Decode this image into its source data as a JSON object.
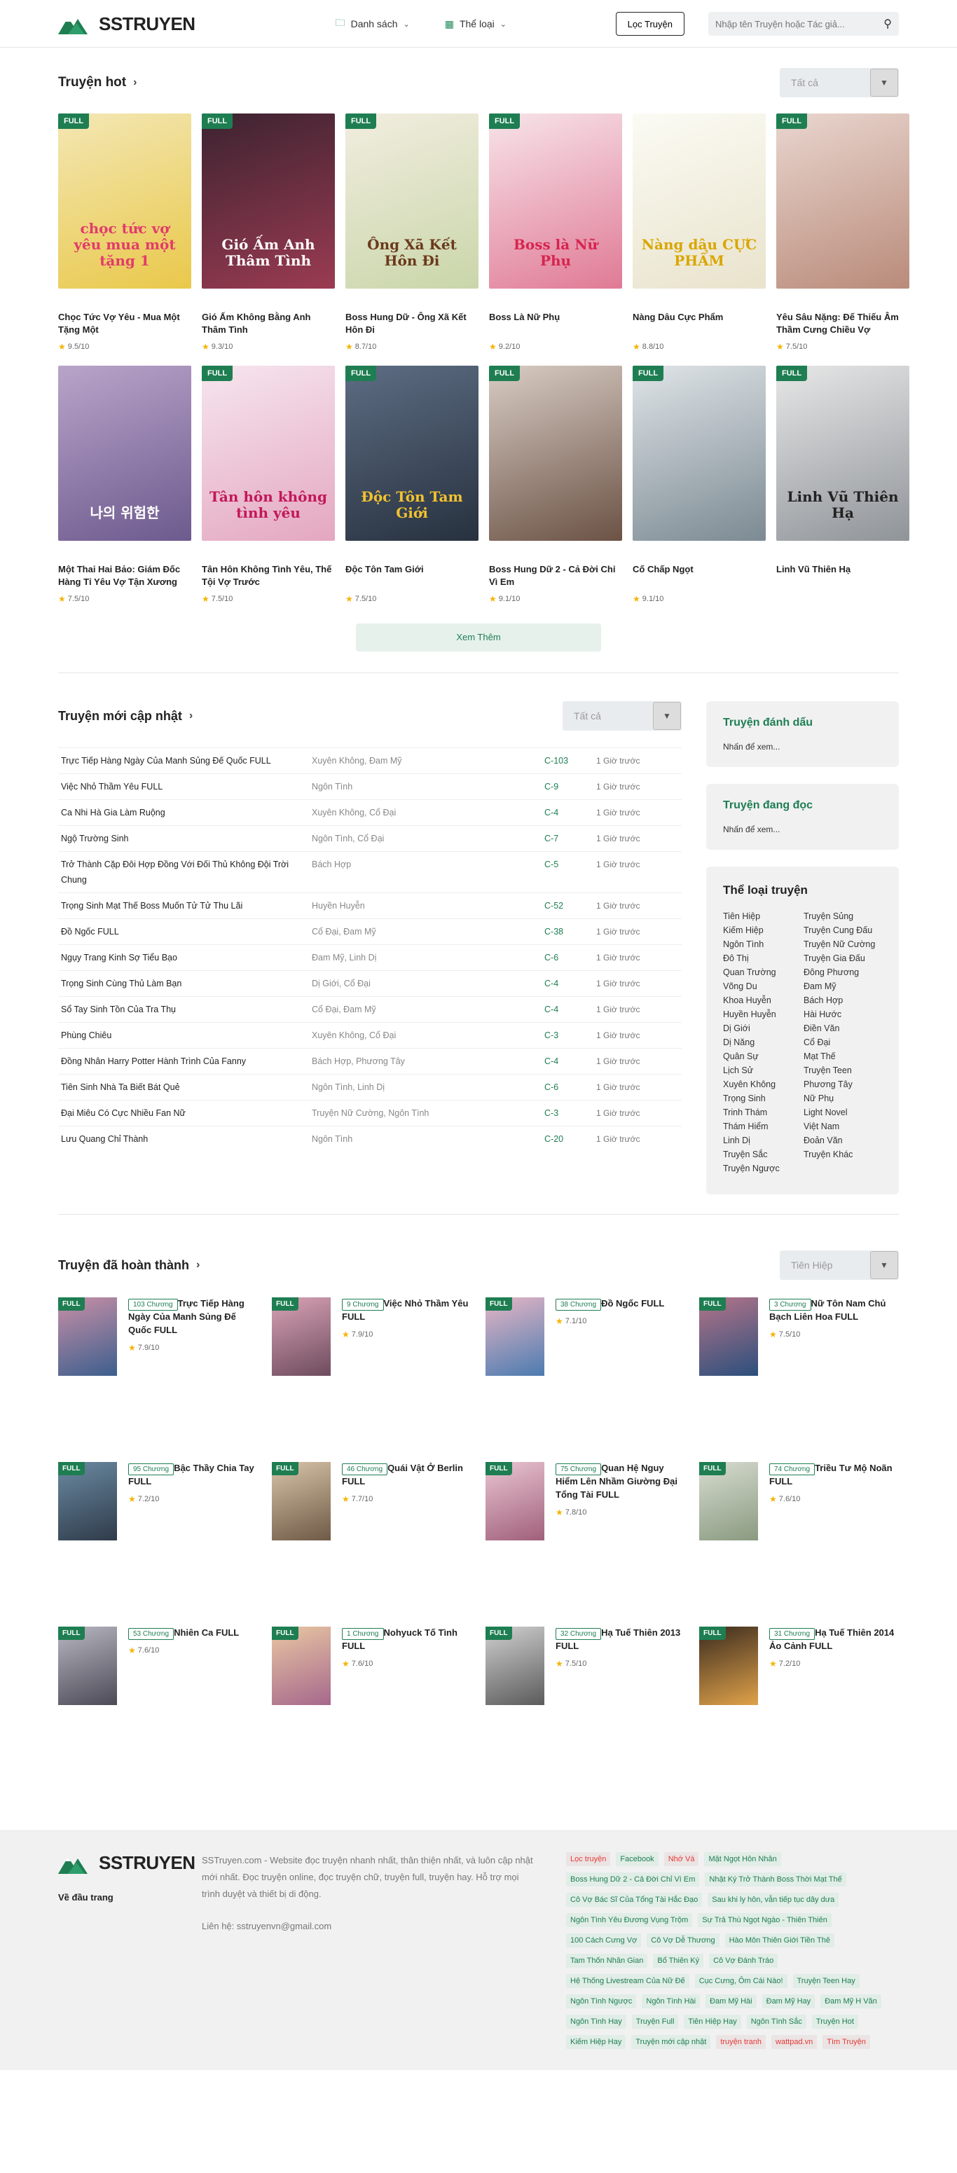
{
  "header": {
    "logo": "SSTRUYEN",
    "nav": [
      {
        "label": "Danh sách"
      },
      {
        "label": "Thể loại"
      }
    ],
    "filter_button": "Lọc Truyện",
    "search_placeholder": "Nhập tên Truyện hoặc Tác giả..."
  },
  "hot": {
    "title": "Truyện hot",
    "select": "Tất cả",
    "full_label": "FULL",
    "items": [
      {
        "title": "Chọc Tức Vợ Yêu - Mua Một Tặng Một",
        "rating": "9.5/10",
        "full": true,
        "cover_text": "chọc tức vợ yêu mua một tặng 1",
        "colors": [
          "#f3e7b4",
          "#e9c84a"
        ],
        "tc": "#e23b6b"
      },
      {
        "title": "Gió Ấm Không Bằng Anh Thâm Tình",
        "rating": "9.3/10",
        "full": true,
        "cover_text": "Gió Ấm Anh Thâm Tình",
        "colors": [
          "#3c2330",
          "#9b3b52"
        ],
        "tc": "#ffffff"
      },
      {
        "title": "Boss Hung Dữ - Ông Xã Kết Hôn Đi",
        "rating": "8.7/10",
        "full": true,
        "cover_text": "Ông Xã Kết Hôn Đi",
        "colors": [
          "#f2ede0",
          "#c9d6a9"
        ],
        "tc": "#6b3a1c"
      },
      {
        "title": "Boss Là Nữ Phụ",
        "rating": "9.2/10",
        "full": true,
        "cover_text": "Boss là Nữ Phụ",
        "colors": [
          "#f7e4ea",
          "#e07a95"
        ],
        "tc": "#d6254f"
      },
      {
        "title": "Nàng Dâu Cực Phẩm",
        "rating": "8.8/10",
        "full": false,
        "cover_text": "Nàng dâu CỰC PHẨM",
        "colors": [
          "#fbfbf4",
          "#e9e3cc"
        ],
        "tc": "#d9a600"
      },
      {
        "title": "Yêu Sâu Nặng: Đế Thiếu Âm Thầm Cưng Chiều Vợ",
        "rating": "7.5/10",
        "full": true,
        "cover_text": "",
        "colors": [
          "#e9d6cf",
          "#b98b7a"
        ],
        "tc": "#ffffff"
      },
      {
        "title": "Một Thai Hai Bảo: Giám Đốc Hàng Tỉ Yêu Vợ Tận Xương",
        "rating": "7.5/10",
        "full": false,
        "cover_text": "나의 위험한",
        "colors": [
          "#b9a4c9",
          "#6d5a8e"
        ],
        "tc": "#ffffff"
      },
      {
        "title": "Tân Hôn Không Tình Yêu, Thế Tội Vợ Trước",
        "rating": "7.5/10",
        "full": true,
        "cover_text": "Tân hôn không tình yêu",
        "colors": [
          "#f6e6ee",
          "#e4a7c0"
        ],
        "tc": "#c2185b"
      },
      {
        "title": "Độc Tôn Tam Giới",
        "rating": "7.5/10",
        "full": true,
        "cover_text": "Độc Tôn Tam Giới",
        "colors": [
          "#5d6d83",
          "#27313f"
        ],
        "tc": "#f2c230"
      },
      {
        "title": "Boss Hung Dữ 2 - Cả Đời Chỉ Vì Em",
        "rating": "9.1/10",
        "full": true,
        "cover_text": "",
        "colors": [
          "#d8ccc4",
          "#6b5245"
        ],
        "tc": "#ffffff"
      },
      {
        "title": "Cố Chấp Ngọt",
        "rating": "9.1/10",
        "full": true,
        "cover_text": "",
        "colors": [
          "#dfe4e7",
          "#7c8a93"
        ],
        "tc": "#ffffff"
      },
      {
        "title": "Linh Vũ Thiên Hạ",
        "rating": "",
        "full": true,
        "cover_text": "Linh Vũ Thiên Hạ",
        "colors": [
          "#e7e7e7",
          "#8f9499"
        ],
        "tc": "#222222"
      }
    ],
    "more_button": "Xem Thêm"
  },
  "updates": {
    "title": "Truyện mới cập nhật",
    "select": "Tất cả",
    "rows": [
      {
        "name": "Trực Tiếp Hàng Ngày Của Manh Sủng Đế Quốc FULL",
        "genre": "Xuyên Không, Đam Mỹ",
        "chapter": "C-103",
        "time": "1 Giờ trước"
      },
      {
        "name": "Việc Nhỏ Thầm Yêu FULL",
        "genre": "Ngôn Tình",
        "chapter": "C-9",
        "time": "1 Giờ trước"
      },
      {
        "name": "Ca Nhi Hà Gia Làm Ruộng",
        "genre": "Xuyên Không, Cổ Đại",
        "chapter": "C-4",
        "time": "1 Giờ trước"
      },
      {
        "name": "Ngộ Trường Sinh",
        "genre": "Ngôn Tình, Cổ Đại",
        "chapter": "C-7",
        "time": "1 Giờ trước"
      },
      {
        "name": "Trở Thành Cặp Đôi Hợp Đồng Với Đối Thủ Không Đội Trời Chung",
        "genre": "Bách Hợp",
        "chapter": "C-5",
        "time": "1 Giờ trước"
      },
      {
        "name": "Trọng Sinh Mạt Thế Boss Muốn Tử Tử Thu Lãi",
        "genre": "Huyền Huyễn",
        "chapter": "C-52",
        "time": "1 Giờ trước"
      },
      {
        "name": "Đồ Ngốc FULL",
        "genre": "Cổ Đại, Đam Mỹ",
        "chapter": "C-38",
        "time": "1 Giờ trước"
      },
      {
        "name": "Ngụy Trang Kinh Sợ Tiểu Bạo",
        "genre": "Đam Mỹ, Linh Dị",
        "chapter": "C-6",
        "time": "1 Giờ trước"
      },
      {
        "name": "Trọng Sinh Cùng Thủ Làm Bạn",
        "genre": "Dị Giới, Cổ Đại",
        "chapter": "C-4",
        "time": "1 Giờ trước"
      },
      {
        "name": "Sổ Tay Sinh Tồn Của Tra Thụ",
        "genre": "Cổ Đại, Đam Mỹ",
        "chapter": "C-4",
        "time": "1 Giờ trước"
      },
      {
        "name": "Phùng Chiêu",
        "genre": "Xuyên Không, Cổ Đại",
        "chapter": "C-3",
        "time": "1 Giờ trước"
      },
      {
        "name": "Đồng Nhân Harry Potter Hành Trình Của Fanny",
        "genre": "Bách Hợp, Phương Tây",
        "chapter": "C-4",
        "time": "1 Giờ trước"
      },
      {
        "name": "Tiên Sinh Nhà Ta Biết Bát Quẻ",
        "genre": "Ngôn Tình, Linh Dị",
        "chapter": "C-6",
        "time": "1 Giờ trước"
      },
      {
        "name": "Đại Miêu Có Cực Nhiều Fan Nữ",
        "genre": "Truyện Nữ Cường, Ngôn Tình",
        "chapter": "C-3",
        "time": "1 Giờ trước"
      },
      {
        "name": "Lưu Quang Chỉ Thành",
        "genre": "Ngôn Tình",
        "chapter": "C-20",
        "time": "1 Giờ trước"
      }
    ]
  },
  "sidebar": {
    "bookmark": {
      "title": "Truyện đánh dấu",
      "hint": "Nhấn để xem..."
    },
    "reading": {
      "title": "Truyện đang đọc",
      "hint": "Nhấn để xem..."
    },
    "categories_title": "Thể loại truyện",
    "categories": [
      "Tiên Hiệp",
      "Truyện Sủng",
      "Kiếm Hiệp",
      "Truyện Cung Đấu",
      "Ngôn Tình",
      "Truyện Nữ Cường",
      "Đô Thị",
      "Truyện Gia Đấu",
      "Quan Trường",
      "Đông Phương",
      "Võng Du",
      "Đam Mỹ",
      "Khoa Huyễn",
      "Bách Hợp",
      "Huyền Huyễn",
      "Hài Hước",
      "Dị Giới",
      "Điền Văn",
      "Dị Năng",
      "Cổ Đại",
      "Quân Sự",
      "Mạt Thế",
      "Lịch Sử",
      "Truyện Teen",
      "Xuyên Không",
      "Phương Tây",
      "Trọng Sinh",
      "Nữ Phụ",
      "Trinh Thám",
      "Light Novel",
      "Thám Hiểm",
      "Việt Nam",
      "Linh Dị",
      "Đoản Văn",
      "Truyện Sắc",
      "Truyện Khác",
      "Truyện Ngược"
    ]
  },
  "completed": {
    "title": "Truyện đã hoàn thành",
    "select": "Tiên Hiệp",
    "items": [
      {
        "chapters": "103 Chương",
        "title": "Trực Tiếp Hàng Ngày Của Manh Sủng Đế Quốc FULL",
        "rating": "7.9/10",
        "colors": [
          "#c98fa7",
          "#3c5f8d"
        ]
      },
      {
        "chapters": "9 Chương",
        "title": "Việc Nhỏ Thầm Yêu FULL",
        "rating": "7.9/10",
        "colors": [
          "#d8a3b5",
          "#6e4b5e"
        ]
      },
      {
        "chapters": "38 Chương",
        "title": "Đồ Ngốc FULL",
        "rating": "7.1/10",
        "colors": [
          "#e7b6c5",
          "#4b7bb0"
        ]
      },
      {
        "chapters": "3 Chương",
        "title": "Nữ Tôn Nam Chủ Bạch Liên Hoa FULL",
        "rating": "7.5/10",
        "colors": [
          "#b57489",
          "#2b4f7c"
        ]
      },
      {
        "chapters": "95 Chương",
        "title": "Bậc Thầy Chia Tay FULL",
        "rating": "7.2/10",
        "colors": [
          "#6a8aa2",
          "#2f3b4a"
        ]
      },
      {
        "chapters": "46 Chương",
        "title": "Quái Vật Ở Berlin FULL",
        "rating": "7.7/10",
        "colors": [
          "#d8c4a8",
          "#6e5a46"
        ]
      },
      {
        "chapters": "75 Chương",
        "title": "Quan Hệ Nguy Hiểm Lên Nhầm Giường Đại Tổng Tài FULL",
        "rating": "7.8/10",
        "colors": [
          "#e9c5d2",
          "#a0607a"
        ]
      },
      {
        "chapters": "74 Chương",
        "title": "Triều Tư Mộ Noãn FULL",
        "rating": "7.6/10",
        "colors": [
          "#d7dcd0",
          "#8a9a80"
        ]
      },
      {
        "chapters": "53 Chương",
        "title": "Nhiên Ca FULL",
        "rating": "7.6/10",
        "colors": [
          "#b9b7c2",
          "#4c4a56"
        ]
      },
      {
        "chapters": "1 Chương",
        "title": "Nohyuck Tố Tình FULL",
        "rating": "7.6/10",
        "colors": [
          "#e9c7a3",
          "#a6688c"
        ]
      },
      {
        "chapters": "32 Chương",
        "title": "Hạ Tuế Thiên 2013 FULL",
        "rating": "7.5/10",
        "colors": [
          "#d0d0d0",
          "#5b5b5b"
        ]
      },
      {
        "chapters": "31 Chương",
        "title": "Hạ Tuế Thiên 2014 Ảo Cảnh FULL",
        "rating": "7.2/10",
        "colors": [
          "#3a2b1f",
          "#e0a24a"
        ]
      }
    ]
  },
  "footer": {
    "back_home": "Về đầu trang",
    "description": "SSTruyen.com - Website đọc truyện nhanh nhất, thân thiện nhất, và luôn cập nhật mới nhất. Đọc truyện online, đọc truyện chữ, truyện full, truyện hay. Hỗ trợ mọi trình duyệt và thiết bị di động.",
    "contact": "Liên hệ: sstruyenvn@gmail.com",
    "tags": [
      {
        "t": "Lọc truyện",
        "red": true
      },
      {
        "t": "Facebook",
        "red": false
      },
      {
        "t": "Nhớ Vá",
        "red": true
      },
      {
        "t": "Mật Ngọt Hôn Nhân",
        "red": false
      },
      {
        "t": "Boss Hung Dữ 2 - Cả Đời Chỉ Vì Em",
        "red": false
      },
      {
        "t": "Nhật Ký Trở Thành Boss Thời Mạt Thế",
        "red": false
      },
      {
        "t": "Cô Vợ Bác Sĩ Của Tổng Tài Hắc Đạo",
        "red": false
      },
      {
        "t": "Sau khi ly hôn, vẫn tiếp tục dây dưa",
        "red": false
      },
      {
        "t": "Ngôn Tình Yêu Đương Vụng Trộm",
        "red": false
      },
      {
        "t": "Sự Trả Thù Ngọt Ngào - Thiên Thiên",
        "red": false
      },
      {
        "t": "100 Cách Cưng Vợ",
        "red": false
      },
      {
        "t": "Cô Vợ Dễ Thương",
        "red": false
      },
      {
        "t": "Hào Môn Thiên Giới Tiền Thê",
        "red": false
      },
      {
        "t": "Tam Thốn Nhân Gian",
        "red": false
      },
      {
        "t": "Bổ Thiên Ký",
        "red": false
      },
      {
        "t": "Cô Vợ Đánh Tráo",
        "red": false
      },
      {
        "t": "Hệ Thống Livestream Của Nữ Đế",
        "red": false
      },
      {
        "t": "Cục Cưng, Ôm Cái Nào!",
        "red": false
      },
      {
        "t": "Truyện Teen Hay",
        "red": false
      },
      {
        "t": "Ngôn Tình Ngược",
        "red": false
      },
      {
        "t": "Ngôn Tình Hài",
        "red": false
      },
      {
        "t": "Đam Mỹ Hài",
        "red": false
      },
      {
        "t": "Đam Mỹ Hay",
        "red": false
      },
      {
        "t": "Đam Mỹ H Văn",
        "red": false
      },
      {
        "t": "Ngôn Tình Hay",
        "red": false
      },
      {
        "t": "Truyện Full",
        "red": false
      },
      {
        "t": "Tiên Hiệp Hay",
        "red": false
      },
      {
        "t": "Ngôn Tình Sắc",
        "red": false
      },
      {
        "t": "Truyện Hot",
        "red": false
      },
      {
        "t": "Kiếm Hiệp Hay",
        "red": false
      },
      {
        "t": "Truyện mới cập nhật",
        "red": false
      },
      {
        "t": "truyện tranh",
        "red": true
      },
      {
        "t": "wattpad.vn",
        "red": true
      },
      {
        "t": "Tìm Truyện",
        "red": true
      }
    ]
  },
  "colors": {
    "brand": "#1e7e52",
    "tag_red": "#e53935",
    "star": "#f4b400"
  }
}
